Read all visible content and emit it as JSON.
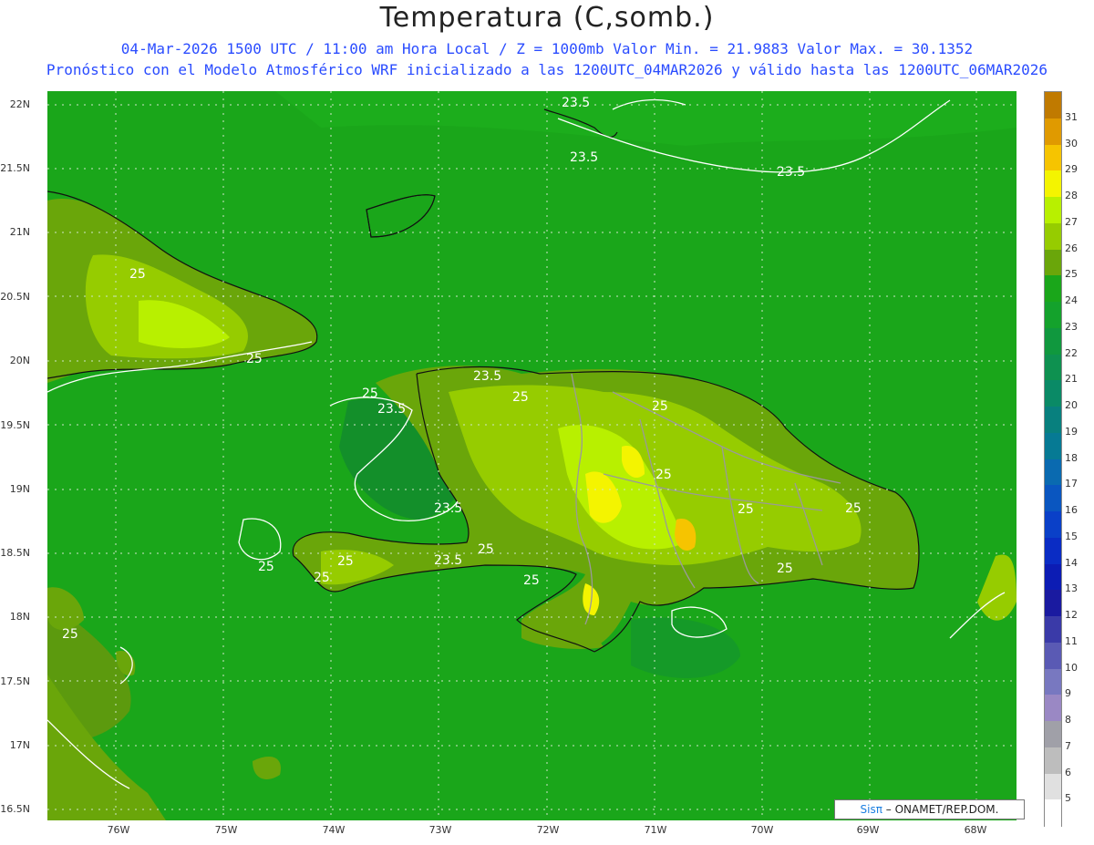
{
  "title": "Temperatura (C,somb.)",
  "subtitle1": "04-Mar-2026 1500 UTC / 11:00 am Hora Local / Z = 1000mb  Valor Min. = 21.9883  Valor Max. = 30.1352",
  "subtitle2": "Pronóstico con el Modelo Atmosférico WRF inicializado a las 1200UTC_04MAR2026 y válido hasta las  1200UTC_06MAR2026",
  "credit": {
    "brand": "Sisπ",
    "text": " – ONAMET/REP.DOM."
  },
  "lat_labels": [
    "22N",
    "21.5N",
    "21N",
    "20.5N",
    "20N",
    "19.5N",
    "19N",
    "18.5N",
    "18N",
    "17.5N",
    "17N",
    "16.5N"
  ],
  "lon_labels": [
    "76W",
    "75W",
    "74W",
    "73W",
    "72W",
    "71W",
    "70W",
    "69W",
    "68W"
  ],
  "contour_labels": [
    "23.5",
    "23.5",
    "23.5",
    "23.5",
    "23.5",
    "23.5",
    "23.5",
    "25",
    "25",
    "25",
    "25",
    "25",
    "25",
    "25",
    "25",
    "25",
    "25",
    "25",
    "25",
    "25",
    "25",
    "25"
  ],
  "colorbar": {
    "labels": [
      "31",
      "30",
      "29",
      "28",
      "27",
      "26",
      "25",
      "24",
      "23",
      "22",
      "21",
      "20",
      "19",
      "18",
      "17",
      "16",
      "15",
      "14",
      "13",
      "12",
      "11",
      "10",
      "9",
      "8",
      "7",
      "6",
      "5"
    ],
    "colors": [
      "#c07a00",
      "#e09a00",
      "#f6c400",
      "#f4f400",
      "#b8f000",
      "#96cc00",
      "#6aa60a",
      "#1aa61a",
      "#14a22c",
      "#10983e",
      "#0e9150",
      "#0a8a66",
      "#08807e",
      "#067a94",
      "#0a6ab0",
      "#0a56c0",
      "#0a40c8",
      "#0a2cc4",
      "#0c1cb4",
      "#1a1aa0",
      "#3a3aa8",
      "#5a5ab4",
      "#7878c0",
      "#9a88c4",
      "#a0a0a8",
      "#bdbdbd",
      "#e0e0e0",
      "#ffffff"
    ]
  }
}
